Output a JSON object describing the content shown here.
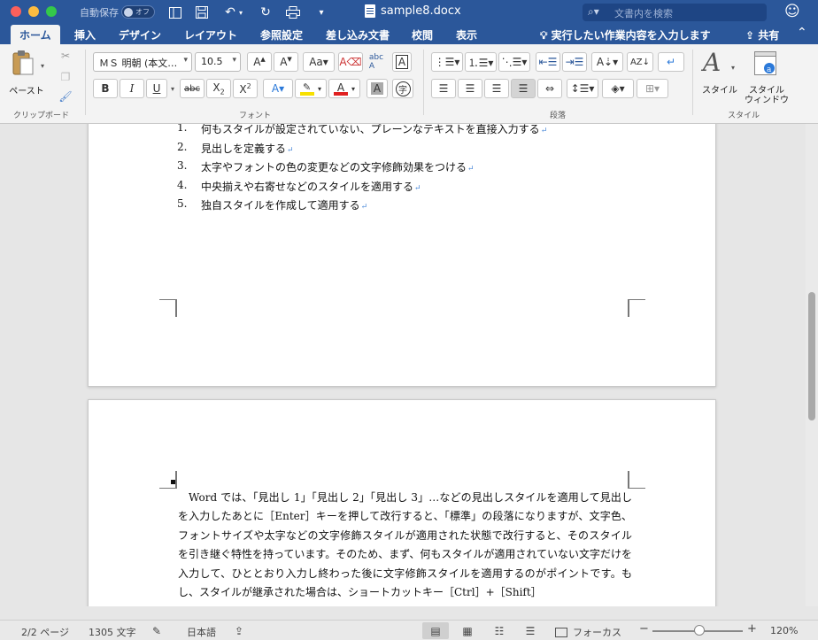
{
  "titlebar": {
    "autosave_label": "自動保存",
    "autosave_state": "オフ",
    "document_title": "sample8.docx",
    "search_placeholder": "文書内を検索"
  },
  "tabs": {
    "home": "ホーム",
    "insert": "挿入",
    "design": "デザイン",
    "layout": "レイアウト",
    "references": "参照設定",
    "mailings": "差し込み文書",
    "review": "校閲",
    "view": "表示",
    "tell_me": "実行したい作業内容を入力します",
    "share": "共有"
  },
  "ribbon": {
    "clipboard": {
      "paste_label": "ペースト",
      "group_label": "クリップボード"
    },
    "font": {
      "font_name": "ＭＳ 明朝 (本文…",
      "font_size": "10.5",
      "group_label": "フォント",
      "colors": {
        "highlight": "#f7e000",
        "font_color": "#e02020"
      }
    },
    "paragraph": {
      "group_label": "段落"
    },
    "styles": {
      "styles_label": "スタイル",
      "styles_pane_label_line1": "スタイル",
      "styles_pane_label_line2": "ウィンドウ",
      "group_label": "スタイル"
    }
  },
  "document": {
    "numbered_list": [
      {
        "num": "1.",
        "text": "何もスタイルが設定されていない、プレーンなテキストを直接入力する"
      },
      {
        "num": "2.",
        "text": "見出しを定義する"
      },
      {
        "num": "3.",
        "text": "太字やフォントの色の変更などの文字修飾効果をつける"
      },
      {
        "num": "4.",
        "text": "中央揃えや右寄せなどのスタイルを適用する"
      },
      {
        "num": "5.",
        "text": "独自スタイルを作成して適用する"
      }
    ],
    "paragraph_mark": "↵",
    "bullet_paragraph": "Word では、「見出し 1」「見出し 2」「見出し 3」…などの見出しスタイルを適用して見出しを入力したあとに［Enter］キーを押して改行すると、「標準」の段落になりますが、文字色、フォントサイズや太字などの文字修飾スタイルが適用された状態で改行すると、そのスタイルを引き継ぐ特性を持っています。そのため、まず、何もスタイルが適用されていない文字だけを入力して、ひととおり入力し終わった後に文字修飾スタイルを適用するのがポイントです。もし、スタイルが継承された場合は、ショートカットキー［Ctrl］+［Shift］"
  },
  "statusbar": {
    "page": "2/2 ページ",
    "word_count": "1305 文字",
    "language": "日本語",
    "focus": "フォーカス",
    "zoom": "120%",
    "zoom_percent": 120
  },
  "icons": {
    "cut": "scissors-icon",
    "copy": "copy-icon",
    "format_painter": "brush-icon",
    "search": "search-icon",
    "profile": "smiley-icon"
  }
}
